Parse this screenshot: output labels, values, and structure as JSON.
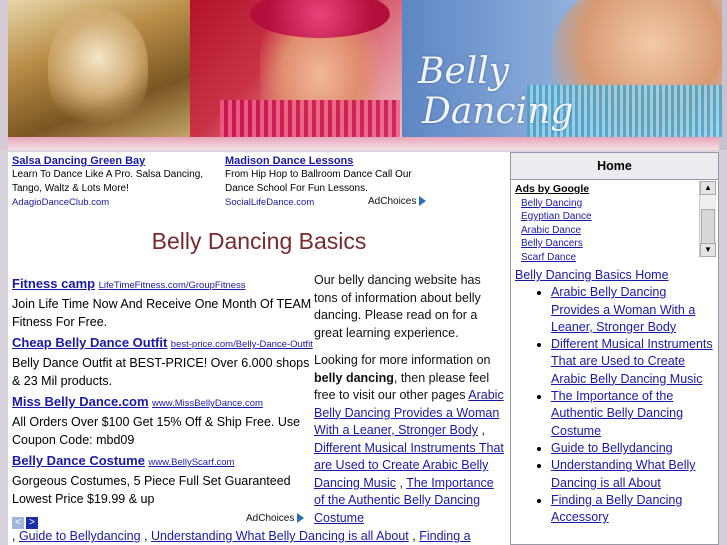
{
  "banner": {
    "logo_line1": "Belly",
    "logo_line2": "Dancing"
  },
  "top_ads": [
    {
      "title": "Salsa Dancing Green Bay",
      "text": "Learn To Dance Like A Pro. Salsa Dancing, Tango, Waltz & Lots More!",
      "url": "AdagioDanceClub.com"
    },
    {
      "title": "Madison Dance Lessons",
      "text": "From Hip Hop to Ballroom Dance Call Our Dance School For Fun Lessons.",
      "url": "SocialLifeDance.com"
    }
  ],
  "adchoices_label": "AdChoices",
  "page_title": "Belly Dancing Basics",
  "left_ads": [
    {
      "title": "Fitness camp",
      "url": "LifeTimeFitness.com/GroupFitness",
      "text": "Join Life Time Now And Receive One Month Of TEAM Fitness For Free."
    },
    {
      "title": "Cheap Belly Dance Outfit",
      "url": "best-price.com/Belly-Dance-Outfit",
      "text": "Belly Dance Outfit at BEST-PRICE! Over 6.000 shops & 23 Mil products."
    },
    {
      "title": "Miss Belly Dance.com",
      "url": "www.MissBellyDance.com",
      "text": "All Orders Over $100 Get 15% Off & Ship Free. Use Coupon Code: mbd09"
    },
    {
      "title": "Belly Dance Costume",
      "url": "www.BellyScarf.com",
      "text": "Gorgeous Costumes, 5 Piece Full Set Guaranteed Lowest Price $19.99 & up"
    }
  ],
  "nav": {
    "prev": "<",
    "next": ">"
  },
  "main": {
    "p1": "Our belly dancing website has tons of information about belly dancing. Please read on for a great learning experience.",
    "p2_before": "Looking for more information on ",
    "p2_bold": "belly dancing",
    "p2_after": ", then please feel free to visit our other pages ",
    "links": [
      "Arabic Belly Dancing Provides a Woman With a Leaner, Stronger Body",
      "Different Musical Instruments That are Used to Create Arabic Belly Dancing Music",
      "The Importance of the Authentic Belly Dancing Costume"
    ],
    "sep": " , ",
    "bottom_links": [
      "Guide to Bellydancing",
      "Understanding What Belly Dancing is all About",
      "Finding a"
    ]
  },
  "sidebar": {
    "home": "Home",
    "ads_by_google": "Ads by Google",
    "ad_links": [
      "Belly Dancing",
      "Egyptian Dance",
      "Arabic Dance",
      "Belly Dancers",
      "Scarf Dance"
    ],
    "scroll_up": "▲",
    "scroll_down": "▼",
    "nav_home": "Belly Dancing Basics Home",
    "nav_items": [
      "Arabic Belly Dancing Provides a Woman With a Leaner, Stronger Body",
      "Different Musical Instruments That are Used to Create Arabic Belly Dancing Music",
      "The Importance of the Authentic Belly Dancing Costume",
      "Guide to Bellydancing",
      "Understanding What Belly Dancing is all About",
      "Finding a Belly Dancing Accessory"
    ]
  }
}
